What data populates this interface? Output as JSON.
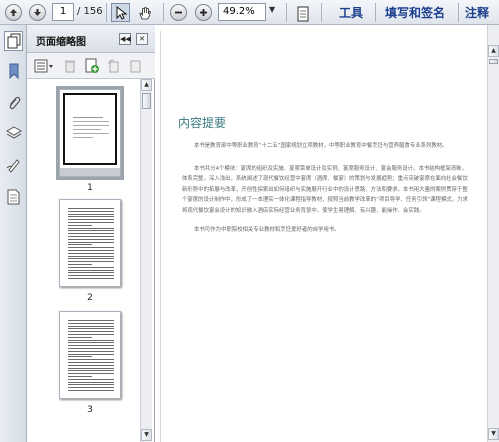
{
  "toolbar": {
    "page_current": "1",
    "page_total": "/ 156",
    "zoom": "49.2%",
    "tools_label": "工具",
    "fill_sign_label": "填写和签名",
    "comment_label": "注释"
  },
  "panel": {
    "title": "页面缩略图",
    "thumbnails": [
      {
        "label": "1"
      },
      {
        "label": "2"
      },
      {
        "label": "3"
      }
    ]
  },
  "document": {
    "section_title": "内容提要",
    "paragraphs": [
      "本书是教育部中等职业教育“十二五”国家规划立项教材，中等职业教育中餐烹饪与营养膳食专业系列教材。",
      "本书共分4个模块：宴席的组织及实施、宴席菜单设计及实例、宴席服务设计、宴会服务设计。本书结构框架清晰，体系完整，深入浅出，系统阐述了现代餐饮经营中宴席（酒席、餐宴）的策划与发展趋势；重点突破宴席在面向社会餐饮新形势中的拓展与改革，开创性探索出如何组织与实施展开行业中的设计思路、方法和要求。本书用大量的案例贯穿于整个宴席的设计制作中，形成了一本理实一体化课程指导教材，按照当前教学改革的“项目导学、任务引领”课程模式，力求将现代餐饮宴会设计的知识融入酒店实际经营业务背景中，使学生易理解、有兴趣、能操作、会实践。",
      "本书可作为中职院校相关专业教材和烹饪爱好者的自学用书。"
    ]
  },
  "colors": {
    "title_color": "#3a7a82",
    "link_color": "#1c3f8e"
  }
}
